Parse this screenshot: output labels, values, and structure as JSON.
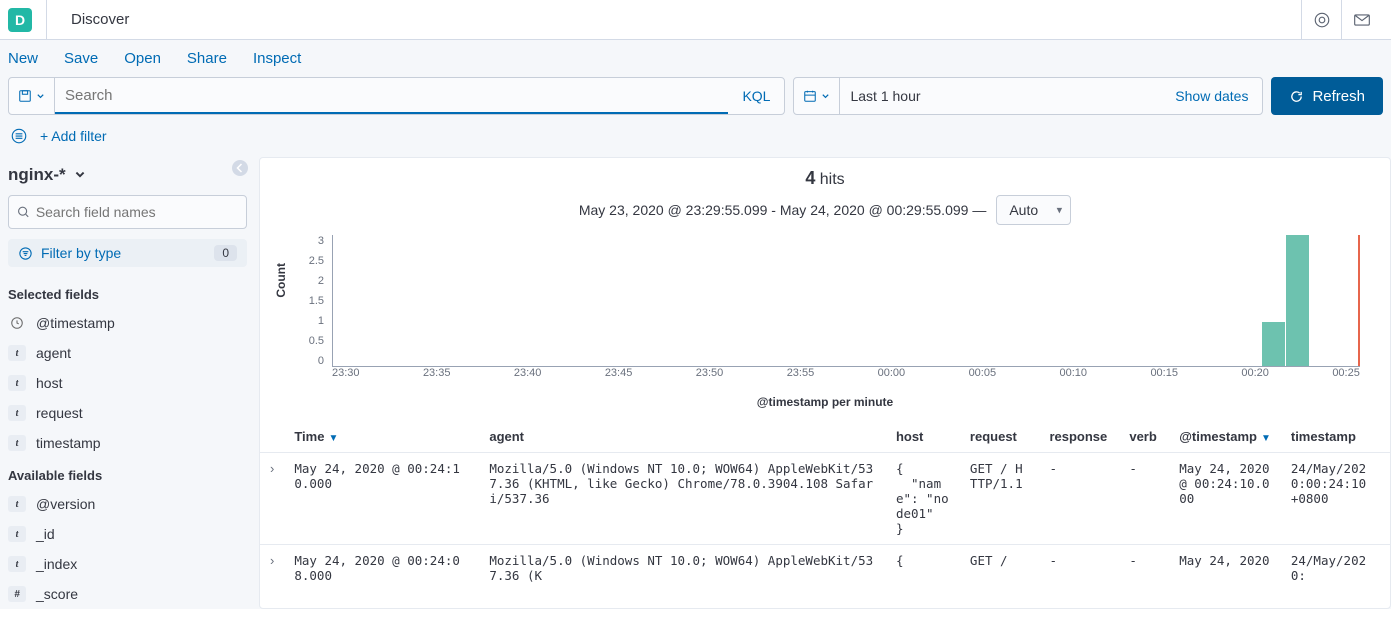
{
  "app": {
    "badge": "D",
    "title": "Discover"
  },
  "nav": {
    "items": [
      "New",
      "Save",
      "Open",
      "Share",
      "Inspect"
    ]
  },
  "searchbar": {
    "placeholder": "Search",
    "kql_label": "KQL"
  },
  "datepicker": {
    "text": "Last 1 hour",
    "show_label": "Show dates"
  },
  "refresh": {
    "label": "Refresh"
  },
  "filter_bar": {
    "add_filter": "+ Add filter"
  },
  "sidebar": {
    "index_pattern": "nginx-*",
    "field_search_placeholder": "Search field names",
    "filter_by_type": "Filter by type",
    "filter_count": "0",
    "selected_header": "Selected fields",
    "available_header": "Available fields",
    "selected": [
      {
        "kind": "clock",
        "name": "@timestamp"
      },
      {
        "kind": "t",
        "name": "agent"
      },
      {
        "kind": "t",
        "name": "host"
      },
      {
        "kind": "t",
        "name": "request"
      },
      {
        "kind": "t",
        "name": "timestamp"
      }
    ],
    "available": [
      {
        "kind": "t",
        "name": "@version"
      },
      {
        "kind": "t",
        "name": "_id"
      },
      {
        "kind": "t",
        "name": "_index"
      },
      {
        "kind": "hash",
        "name": "_score"
      }
    ]
  },
  "hits": {
    "count": "4",
    "word": "hits"
  },
  "timerange": {
    "text": "May 23, 2020 @ 23:29:55.099 - May 24, 2020 @ 00:29:55.099 —",
    "interval": "Auto"
  },
  "chart_data": {
    "type": "bar",
    "title": "",
    "ylabel": "Count",
    "xlabel": "@timestamp per minute",
    "ylim": [
      0,
      3
    ],
    "yticks": [
      "3",
      "2.5",
      "2",
      "1.5",
      "1",
      "0.5",
      "0"
    ],
    "categories": [
      "23:30",
      "23:35",
      "23:40",
      "23:45",
      "23:50",
      "23:55",
      "00:00",
      "00:05",
      "00:10",
      "00:15",
      "00:20",
      "00:25"
    ],
    "bars": [
      {
        "x": 0.905,
        "value": 1
      },
      {
        "x": 0.928,
        "value": 3
      }
    ],
    "brush_x": 0.998
  },
  "table": {
    "columns": [
      "Time",
      "agent",
      "host",
      "request",
      "response",
      "verb",
      "@timestamp",
      "timestamp"
    ],
    "rows": [
      {
        "time": "May 24, 2020 @ 00:24:10.000",
        "agent": "Mozilla/5.0 (Windows NT 10.0; WOW64) AppleWebKit/537.36 (KHTML, like Gecko) Chrome/78.0.3904.108 Safari/537.36",
        "host": "{\n  \"name\": \"node01\"\n}",
        "request": "GET / HTTP/1.1",
        "response": "-",
        "verb": "-",
        "ts": "May 24, 2020 @ 00:24:10.000",
        "timestamp": "24/May/2020:00:24:10 +0800"
      },
      {
        "time": "May 24, 2020 @ 00:24:08.000",
        "agent": "Mozilla/5.0 (Windows NT 10.0; WOW64) AppleWebKit/537.36 (K",
        "host": "{",
        "request": "GET /",
        "response": "-",
        "verb": "-",
        "ts": "May 24, 2020",
        "timestamp": "24/May/2020:"
      }
    ]
  }
}
